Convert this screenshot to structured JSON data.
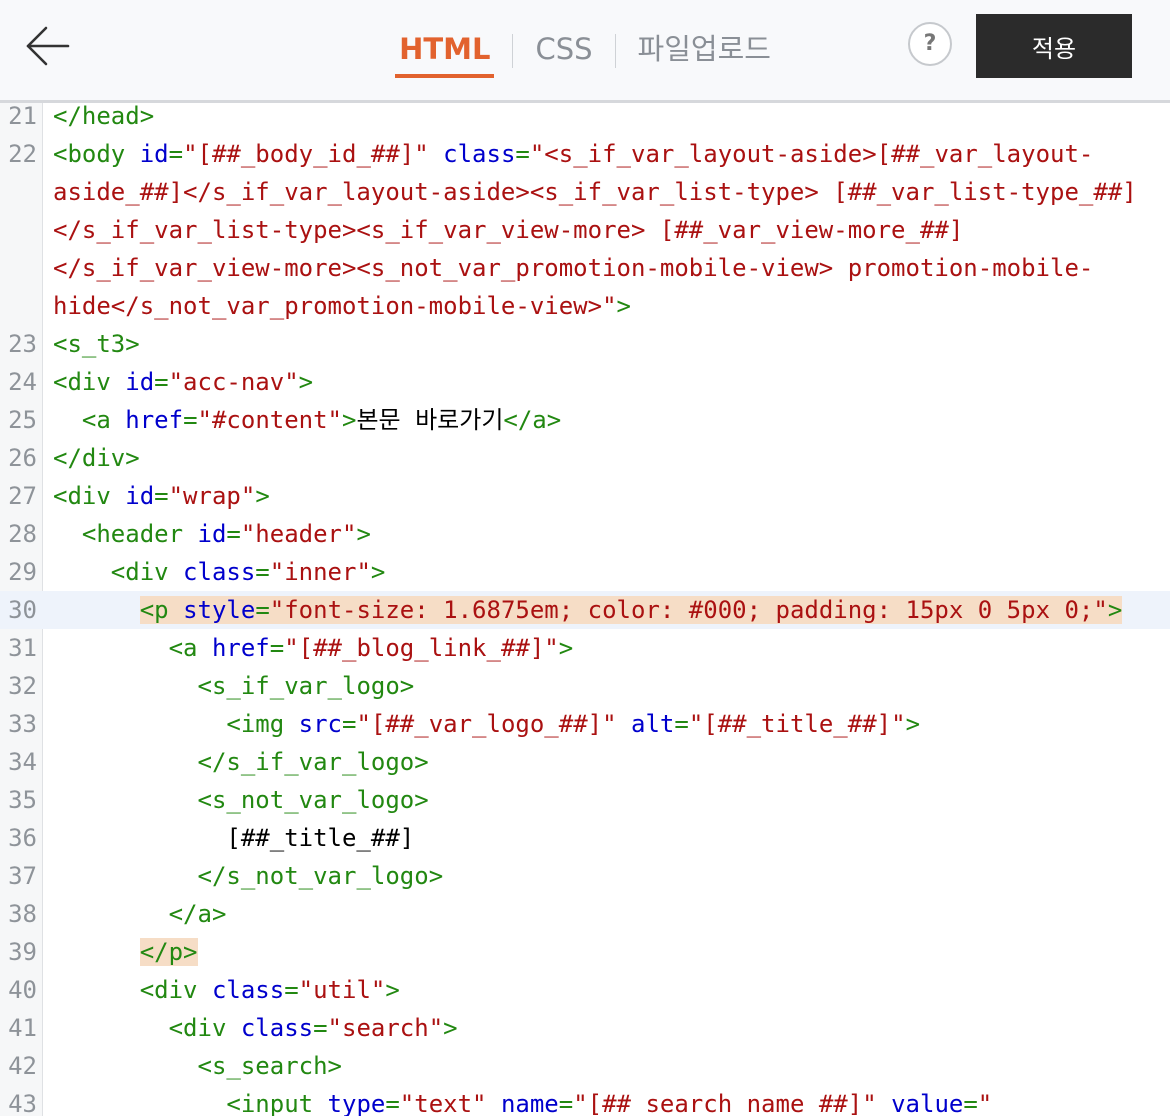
{
  "header": {
    "tabs": [
      {
        "label": "HTML",
        "active": true
      },
      {
        "label": "CSS",
        "active": false
      },
      {
        "label": "파일업로드",
        "active": false
      }
    ],
    "help_label": "?",
    "apply_label": "적용",
    "accent_color": "#e2622e"
  },
  "editor": {
    "active_line": 30,
    "lines": [
      {
        "n": "21",
        "rows": [
          [
            [
              "t",
              "</head>"
            ]
          ]
        ]
      },
      {
        "n": "22",
        "rows": [
          [
            [
              "t",
              "<body "
            ],
            [
              "a",
              "id"
            ],
            [
              "t",
              "="
            ],
            [
              "s",
              "\"[##_body_id_##]\""
            ],
            [
              "t",
              " "
            ],
            [
              "a",
              "class"
            ],
            [
              "t",
              "="
            ],
            [
              "s",
              "\"<s_if_var_layout-aside>[##_var_layout-"
            ]
          ],
          [
            [
              "s",
              "aside_##]</s_if_var_layout-aside><s_if_var_list-type> [##_var_list-type_##]"
            ]
          ],
          [
            [
              "s",
              "</s_if_var_list-type><s_if_var_view-more> [##_var_view-more_##]"
            ]
          ],
          [
            [
              "s",
              "</s_if_var_view-more><s_not_var_promotion-mobile-view> promotion-mobile-"
            ]
          ],
          [
            [
              "s",
              "hide</s_not_var_promotion-mobile-view>\""
            ],
            [
              "t",
              ">"
            ]
          ]
        ]
      },
      {
        "n": "23",
        "rows": [
          [
            [
              "t",
              "<s_t3>"
            ]
          ]
        ]
      },
      {
        "n": "24",
        "rows": [
          [
            [
              "t",
              "<div "
            ],
            [
              "a",
              "id"
            ],
            [
              "t",
              "="
            ],
            [
              "s",
              "\"acc-nav\""
            ],
            [
              "t",
              ">"
            ]
          ]
        ]
      },
      {
        "n": "25",
        "rows": [
          [
            [
              "x",
              "  "
            ],
            [
              "t",
              "<a "
            ],
            [
              "a",
              "href"
            ],
            [
              "t",
              "="
            ],
            [
              "s",
              "\"#content\""
            ],
            [
              "t",
              ">"
            ],
            [
              "x",
              "본문 바로가기"
            ],
            [
              "t",
              "</a>"
            ]
          ]
        ]
      },
      {
        "n": "26",
        "rows": [
          [
            [
              "t",
              "</div>"
            ]
          ]
        ]
      },
      {
        "n": "27",
        "rows": [
          [
            [
              "t",
              "<div "
            ],
            [
              "a",
              "id"
            ],
            [
              "t",
              "="
            ],
            [
              "s",
              "\"wrap\""
            ],
            [
              "t",
              ">"
            ]
          ]
        ]
      },
      {
        "n": "28",
        "rows": [
          [
            [
              "x",
              "  "
            ],
            [
              "t",
              "<header "
            ],
            [
              "a",
              "id"
            ],
            [
              "t",
              "="
            ],
            [
              "s",
              "\"header\""
            ],
            [
              "t",
              ">"
            ]
          ]
        ]
      },
      {
        "n": "29",
        "rows": [
          [
            [
              "x",
              "    "
            ],
            [
              "t",
              "<div "
            ],
            [
              "a",
              "class"
            ],
            [
              "t",
              "="
            ],
            [
              "s",
              "\"inner\""
            ],
            [
              "t",
              ">"
            ]
          ]
        ]
      },
      {
        "n": "30",
        "rows": [
          [
            [
              "x",
              "      "
            ],
            [
              "t hl",
              "<p "
            ],
            [
              "a hl",
              "style"
            ],
            [
              "t hl",
              "="
            ],
            [
              "s hl",
              "\"font-size: 1.6875em; color: #000; padding: 15px 0 5px 0;\""
            ],
            [
              "t hl",
              ">"
            ]
          ]
        ]
      },
      {
        "n": "31",
        "rows": [
          [
            [
              "x",
              "        "
            ],
            [
              "t",
              "<a "
            ],
            [
              "a",
              "href"
            ],
            [
              "t",
              "="
            ],
            [
              "s",
              "\"[##_blog_link_##]\""
            ],
            [
              "t",
              ">"
            ]
          ]
        ]
      },
      {
        "n": "32",
        "rows": [
          [
            [
              "x",
              "          "
            ],
            [
              "t",
              "<s_if_var_logo>"
            ]
          ]
        ]
      },
      {
        "n": "33",
        "rows": [
          [
            [
              "x",
              "            "
            ],
            [
              "t",
              "<img "
            ],
            [
              "a",
              "src"
            ],
            [
              "t",
              "="
            ],
            [
              "s",
              "\"[##_var_logo_##]\""
            ],
            [
              "t",
              " "
            ],
            [
              "a",
              "alt"
            ],
            [
              "t",
              "="
            ],
            [
              "s",
              "\"[##_title_##]\""
            ],
            [
              "t",
              ">"
            ]
          ]
        ]
      },
      {
        "n": "34",
        "rows": [
          [
            [
              "x",
              "          "
            ],
            [
              "t",
              "</s_if_var_logo>"
            ]
          ]
        ]
      },
      {
        "n": "35",
        "rows": [
          [
            [
              "x",
              "          "
            ],
            [
              "t",
              "<s_not_var_logo>"
            ]
          ]
        ]
      },
      {
        "n": "36",
        "rows": [
          [
            [
              "x",
              "            [##_title_##]"
            ]
          ]
        ]
      },
      {
        "n": "37",
        "rows": [
          [
            [
              "x",
              "          "
            ],
            [
              "t",
              "</s_not_var_logo>"
            ]
          ]
        ]
      },
      {
        "n": "38",
        "rows": [
          [
            [
              "x",
              "        "
            ],
            [
              "t",
              "</a>"
            ]
          ]
        ]
      },
      {
        "n": "39",
        "rows": [
          [
            [
              "x",
              "      "
            ],
            [
              "t hl",
              "</p>"
            ]
          ]
        ]
      },
      {
        "n": "40",
        "rows": [
          [
            [
              "x",
              "      "
            ],
            [
              "t",
              "<div "
            ],
            [
              "a",
              "class"
            ],
            [
              "t",
              "="
            ],
            [
              "s",
              "\"util\""
            ],
            [
              "t",
              ">"
            ]
          ]
        ]
      },
      {
        "n": "41",
        "rows": [
          [
            [
              "x",
              "        "
            ],
            [
              "t",
              "<div "
            ],
            [
              "a",
              "class"
            ],
            [
              "t",
              "="
            ],
            [
              "s",
              "\"search\""
            ],
            [
              "t",
              ">"
            ]
          ]
        ]
      },
      {
        "n": "42",
        "rows": [
          [
            [
              "x",
              "          "
            ],
            [
              "t",
              "<s_search>"
            ]
          ]
        ]
      },
      {
        "n": "43",
        "rows": [
          [
            [
              "x",
              "            "
            ],
            [
              "t",
              "<input "
            ],
            [
              "a",
              "type"
            ],
            [
              "t",
              "="
            ],
            [
              "s",
              "\"text\""
            ],
            [
              "t",
              " "
            ],
            [
              "a",
              "name"
            ],
            [
              "t",
              "="
            ],
            [
              "s",
              "\"[##_search_name_##]\""
            ],
            [
              "t",
              " "
            ],
            [
              "a",
              "value"
            ],
            [
              "t",
              "="
            ],
            [
              "s",
              "\""
            ]
          ]
        ]
      }
    ]
  }
}
